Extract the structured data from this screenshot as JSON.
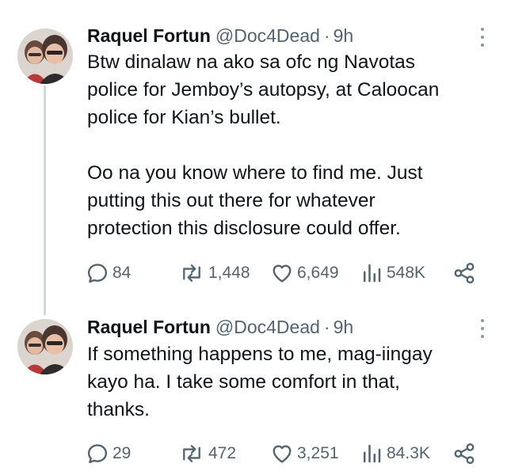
{
  "tweets": [
    {
      "author_name": "Raquel Fortun",
      "handle": "@Doc4Dead",
      "separator": "·",
      "time": "9h",
      "paragraphs": [
        [
          "Btw dinalaw na ako sa ofc ng Navotas",
          "police for Jemboy’s autopsy, at Caloocan",
          "police for Kian’s bullet."
        ],
        [
          "Oo na you know where to find me. Just",
          "putting this out there for whatever",
          "protection this disclosure could offer."
        ]
      ],
      "replies": "84",
      "reposts": "1,448",
      "likes": "6,649",
      "views": "548K"
    },
    {
      "author_name": "Raquel Fortun",
      "handle": "@Doc4Dead",
      "separator": "·",
      "time": "9h",
      "paragraphs": [
        [
          "If something happens to me, mag-iingay",
          "kayo ha. I take some comfort in that,",
          "thanks."
        ]
      ],
      "replies": "29",
      "reposts": "472",
      "likes": "3,251",
      "views": "84.3K"
    }
  ],
  "icons": {
    "reply": "reply-icon",
    "repost": "repost-icon",
    "like": "heart-icon",
    "views": "views-icon",
    "share": "share-icon",
    "more": "more-icon"
  },
  "colors": {
    "text": "#0f1419",
    "muted": "#536471",
    "thread_line": "#cfd9de"
  }
}
